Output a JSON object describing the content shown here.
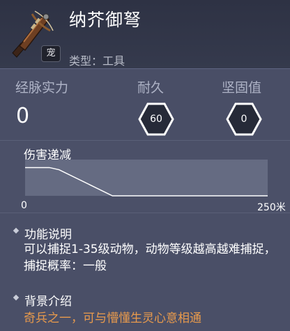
{
  "item": {
    "name": "纳芥御弩",
    "pet_badge": "宠",
    "type_label": "类型：工具",
    "icon": "crossbow-icon"
  },
  "stats": {
    "power_label": "经脉实力",
    "power_value": "0",
    "durability_label": "耐久",
    "durability_value": "60",
    "solidity_label": "坚固值",
    "solidity_value": "0"
  },
  "damage_falloff": {
    "title": "伤害递减",
    "x_min_label": "0",
    "x_max_label": "250米"
  },
  "chart_data": {
    "type": "line",
    "title": "伤害递减",
    "x_tick_labels": [
      "0",
      "250米"
    ],
    "xlim": [
      0,
      250
    ],
    "ylim": [
      0,
      1
    ],
    "x": [
      0,
      25,
      35,
      90,
      250
    ],
    "y": [
      0.78,
      0.78,
      0.72,
      0.0,
      0.0
    ],
    "grid": false
  },
  "description": {
    "function_title": "功能说明",
    "function_text": "可以捕捉1-35级动物，动物等级越高越难捕捉，捕捉概率：一般",
    "background_title": "背景介绍",
    "background_text": "奇兵之一，可与懵懂生灵心意相通"
  },
  "colors": {
    "background_text": "#e89a4c",
    "panel": "#4a5068"
  }
}
